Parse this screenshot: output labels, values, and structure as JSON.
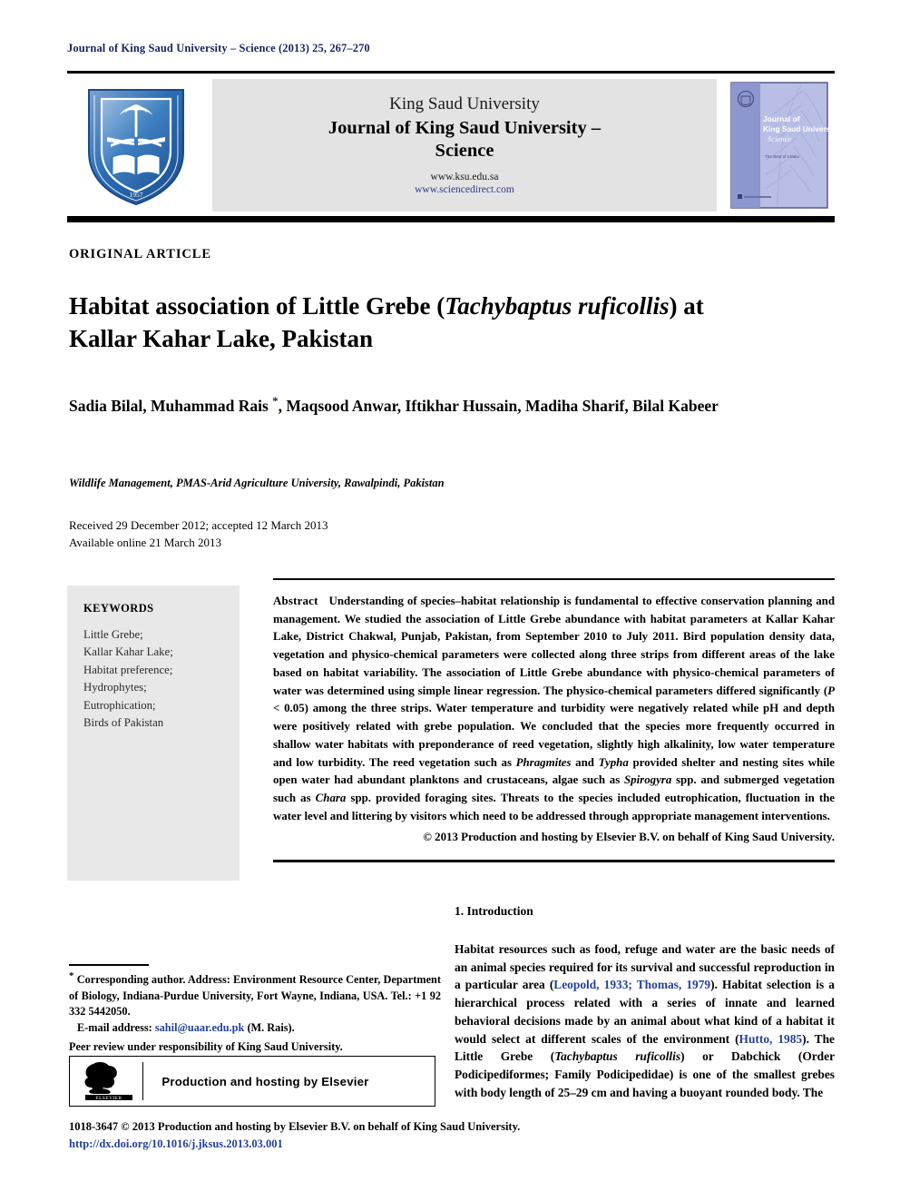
{
  "running_head": "Journal of King Saud University – Science (2013) 25, 267–270",
  "masthead": {
    "logo_alt": "King Saud University crest",
    "line1": "King Saud University",
    "line2": "Journal of King Saud University – Science",
    "url_ksu": "www.ksu.edu.sa",
    "url_sciencedirect": "www.sciencedirect.com",
    "cover": {
      "line1": "Journal of",
      "line2": "King Saud University",
      "line3": "Science",
      "line4": "The Best of Arabia"
    }
  },
  "article": {
    "type_label": "ORIGINAL ARTICLE",
    "title_part1": "Habitat association of Little Grebe (",
    "title_italic1": "Tachybaptus",
    "title_italic2": "ruficollis",
    "title_part2": ") at Kallar Kahar Lake, Pakistan",
    "authors": "Sadia Bilal, Muhammad Rais , Maqsood Anwar, Iftikhar Hussain, Madiha Sharif, Bilal Kabeer",
    "author_star": "*",
    "affiliation": "Wildlife Management, PMAS-Arid Agriculture University, Rawalpindi, Pakistan",
    "received": "Received 29 December 2012; accepted 12 March 2013",
    "available_online": "Available online 21 March 2013"
  },
  "keywords": {
    "heading": "KEYWORDS",
    "items": [
      "Little Grebe;",
      "Kallar Kahar Lake;",
      "Habitat preference;",
      "Hydrophytes;",
      "Eutrophication;",
      "Birds of Pakistan"
    ]
  },
  "abstract": {
    "label": "Abstract",
    "text": "Understanding of species–habitat relationship is fundamental to effective conservation planning and management. We studied the association of Little Grebe abundance with habitat parameters at Kallar Kahar Lake, District Chakwal, Punjab, Pakistan, from September 2010 to July 2011. Bird population density data, vegetation and physico-chemical parameters were collected along three strips from different areas of the lake based on habitat variability. The association of Little Grebe abundance with physico-chemical parameters of water was determined using simple linear regression. The physico-chemical parameters differed significantly (P < 0.05) among the three strips. Water temperature and turbidity were negatively related while pH and depth were positively related with grebe population. We concluded that the species more frequently occurred in shallow water habitats with preponderance of reed vegetation, slightly high alkalinity, low water temperature and low turbidity. The reed vegetation such as Phragmites and Typha provided shelter and nesting sites while open water had abundant planktons and crustaceans, algae such as Spirogyra spp. and submerged vegetation such as Chara spp. provided foraging sites. Threats to the species included eutrophication, fluctuation in the water level and littering by visitors which need to be addressed through appropriate management interventions.",
    "copyright": "© 2013 Production and hosting by Elsevier B.V. on behalf of King Saud University."
  },
  "introduction": {
    "heading": "1. Introduction",
    "text": "Habitat resources such as food, refuge and water are the basic needs of an animal species required for its survival and successful reproduction in a particular area (Leopold, 1933; Thomas, 1979). Habitat selection is a hierarchical process related with a series of innate and learned behavioral decisions made by an animal about what kind of a habitat it would select at different scales of the environment (Hutto, 1985). The Little Grebe (Tachybaptus ruficollis) or Dabchick (Order Podicipediformes; Family Podicipedidae) is one of the smallest grebes with body length of 25–29 cm and having a buoyant rounded body. The",
    "citation1": "Leopold, 1933; Thomas, 1979",
    "citation2": "Hutto, 1985"
  },
  "footnote": {
    "star": "*",
    "corresponding": "Corresponding author. Address: Environment Resource Center, Department of Biology, Indiana-Purdue University, Fort Wayne, Indiana, USA. Tel.: +1 92 332 5442050.",
    "email_label": "E-mail address:",
    "email": "sahil@uaar.edu.pk",
    "email_suffix": "(M. Rais).",
    "peer_review": "Peer review under responsibility of King Saud University."
  },
  "elsevier_box": {
    "logo_label": "ELSEVIER",
    "text": "Production and hosting by Elsevier"
  },
  "colophon": {
    "line1": "1018-3647 © 2013 Production and hosting by Elsevier B.V. on behalf of King Saud University.",
    "doi": "http://dx.doi.org/10.1016/j.jksus.2013.03.001"
  },
  "colors": {
    "navy": "#14265c",
    "link_blue": "#24409a",
    "band_gray": "#e3e3e3",
    "keyword_gray": "#e8e8e8"
  }
}
